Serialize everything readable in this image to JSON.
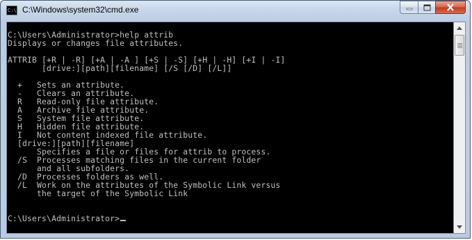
{
  "window": {
    "title": "C:\\Windows\\system32\\cmd.exe",
    "icon_text": "C:\\"
  },
  "colors": {
    "console_bg": "#000000",
    "console_fg": "#c0c0c0",
    "close_button": "#c2391b"
  },
  "console": {
    "lines": [
      "C:\\Users\\Administrator>help attrib",
      "Displays or changes file attributes.",
      "",
      "ATTRIB [+R | -R] [+A | -A ] [+S | -S] [+H | -H] [+I | -I]",
      "       [drive:][path][filename] [/S [/D] [/L]]",
      "",
      "  +   Sets an attribute.",
      "  -   Clears an attribute.",
      "  R   Read-only file attribute.",
      "  A   Archive file attribute.",
      "  S   System file attribute.",
      "  H   Hidden file attribute.",
      "  I   Not content indexed file attribute.",
      "  [drive:][path][filename]",
      "      Specifies a file or files for attrib to process.",
      "  /S  Processes matching files in the current folder",
      "      and all subfolders.",
      "  /D  Processes folders as well.",
      "  /L  Work on the attributes of the Symbolic Link versus",
      "      the target of the Symbolic Link",
      "",
      ""
    ],
    "prompt": "C:\\Users\\Administrator>"
  }
}
